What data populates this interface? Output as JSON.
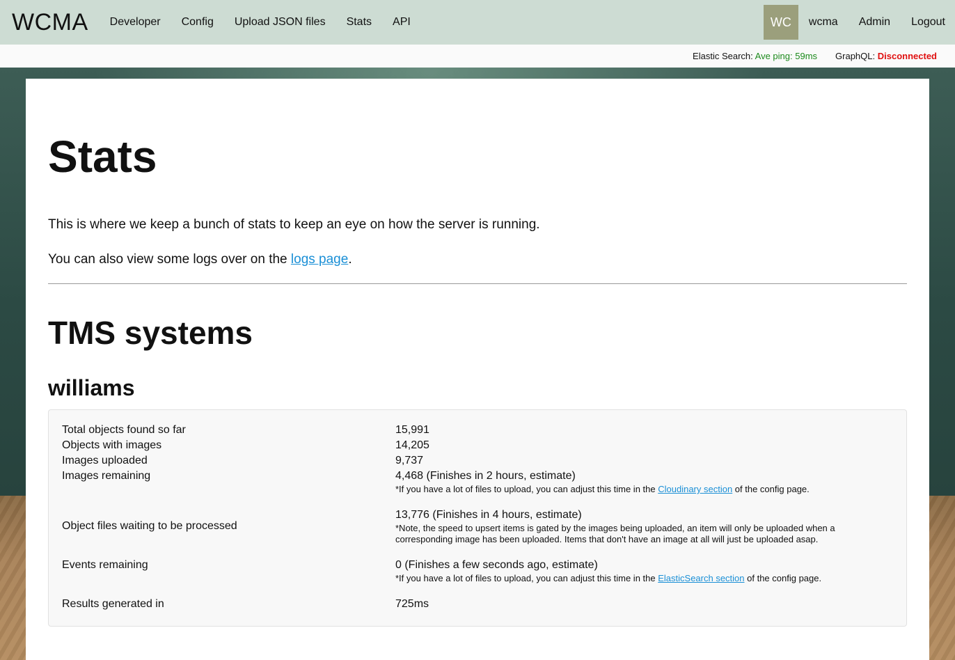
{
  "nav": {
    "brand": "WCMA",
    "links": [
      "Developer",
      "Config",
      "Upload JSON files",
      "Stats",
      "API"
    ],
    "avatar": "WC",
    "user": "wcma",
    "admin": "Admin",
    "logout": "Logout"
  },
  "status": {
    "es_label": "Elastic Search:",
    "es_value": "Ave ping: 59ms",
    "gql_label": "GraphQL:",
    "gql_value": "Disconnected"
  },
  "page": {
    "title": "Stats",
    "intro": "This is where we keep a bunch of stats to keep an eye on how the server is running.",
    "intro2_prefix": "You can also view some logs over on the ",
    "intro2_link": "logs page",
    "intro2_suffix": ".",
    "section_title": "TMS systems",
    "system_name": "williams"
  },
  "stats": {
    "total_objects_label": "Total objects found so far",
    "total_objects_value": "15,991",
    "objects_with_images_label": "Objects with images",
    "objects_with_images_value": "14,205",
    "images_uploaded_label": "Images uploaded",
    "images_uploaded_value": "9,737",
    "images_remaining_label": "Images remaining",
    "images_remaining_value": "4,468 (Finishes in 2 hours, estimate)",
    "images_remaining_note_prefix": "*If you have a lot of files to upload, you can adjust this time in the ",
    "images_remaining_note_link": "Cloudinary section",
    "images_remaining_note_suffix": " of the config page.",
    "object_files_label": "Object files waiting to be processed",
    "object_files_value": "13,776 (Finishes in 4 hours, estimate)",
    "object_files_note": "*Note, the speed to upsert items is gated by the images being uploaded, an item will only be uploaded when a corresponding image has been uploaded. Items that don't have an image at all will just be uploaded asap.",
    "events_label": "Events remaining",
    "events_value": "0 (Finishes a few seconds ago, estimate)",
    "events_note_prefix": "*If you have a lot of files to upload, you can adjust this time in the ",
    "events_note_link": "ElasticSearch section",
    "events_note_suffix": " of the config page.",
    "results_label": "Results generated in",
    "results_value": "725ms"
  }
}
